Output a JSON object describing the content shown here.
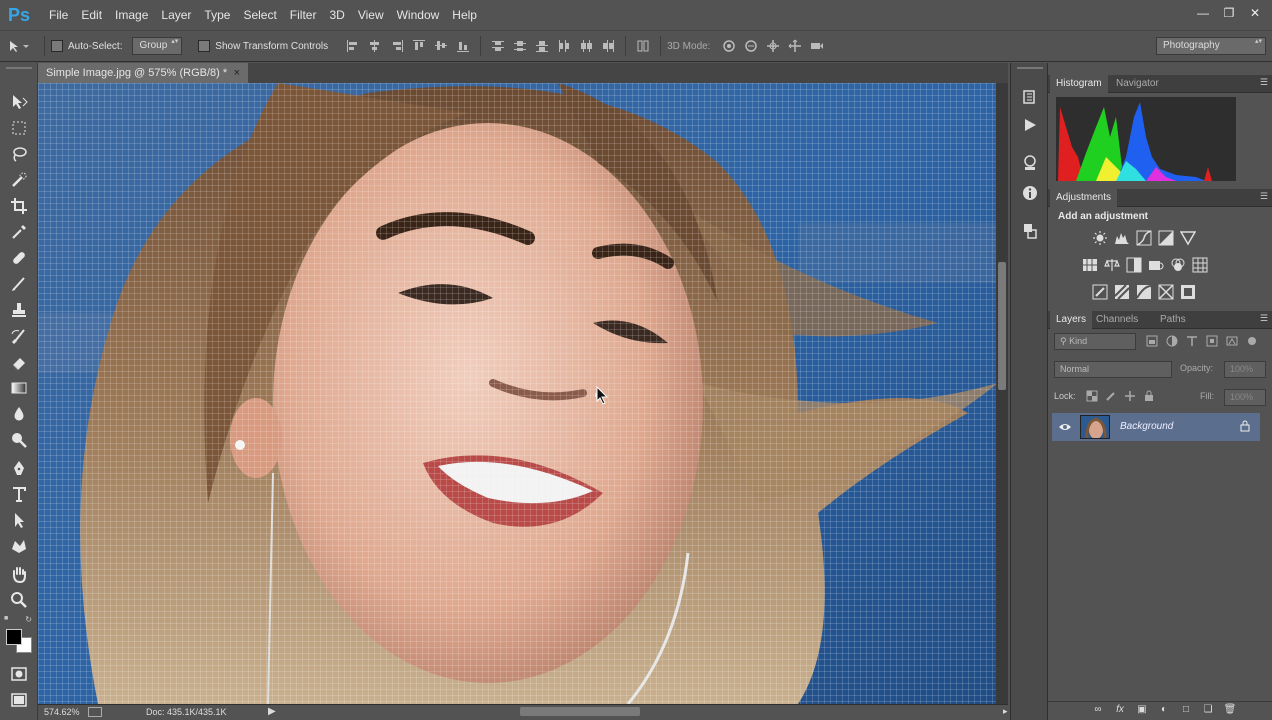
{
  "app": {
    "logo_text": "Ps"
  },
  "menu": [
    "File",
    "Edit",
    "Image",
    "Layer",
    "Type",
    "Select",
    "Filter",
    "3D",
    "View",
    "Window",
    "Help"
  ],
  "options": {
    "auto_select_label": "Auto-Select:",
    "auto_select_value": "Group",
    "show_transform_label": "Show Transform Controls",
    "mode_3d_label": "3D Mode:",
    "workspace": "Photography"
  },
  "document": {
    "tab_title": "Simple Image.jpg @ 575% (RGB/8) *",
    "close_glyph": "×"
  },
  "status": {
    "zoom": "574.62%",
    "doc_info": "Doc: 435.1K/435.1K"
  },
  "panels": {
    "histogram_tabs": [
      "Histogram",
      "Navigator"
    ],
    "adjustments_tab": "Adjustments",
    "adjustments_heading": "Add an adjustment",
    "layers_tabs": [
      "Layers",
      "Channels",
      "Paths"
    ],
    "filter_kind": "Kind",
    "blend_mode": "Normal",
    "opacity_label": "Opacity:",
    "opacity_value": "100%",
    "lock_label": "Lock:",
    "fill_label": "Fill:",
    "fill_value": "100%",
    "layer_name": "Background"
  },
  "colors": {
    "accent": "#35a7e8",
    "panel_bg": "#535353",
    "selected_layer": "#5c6e8e"
  }
}
